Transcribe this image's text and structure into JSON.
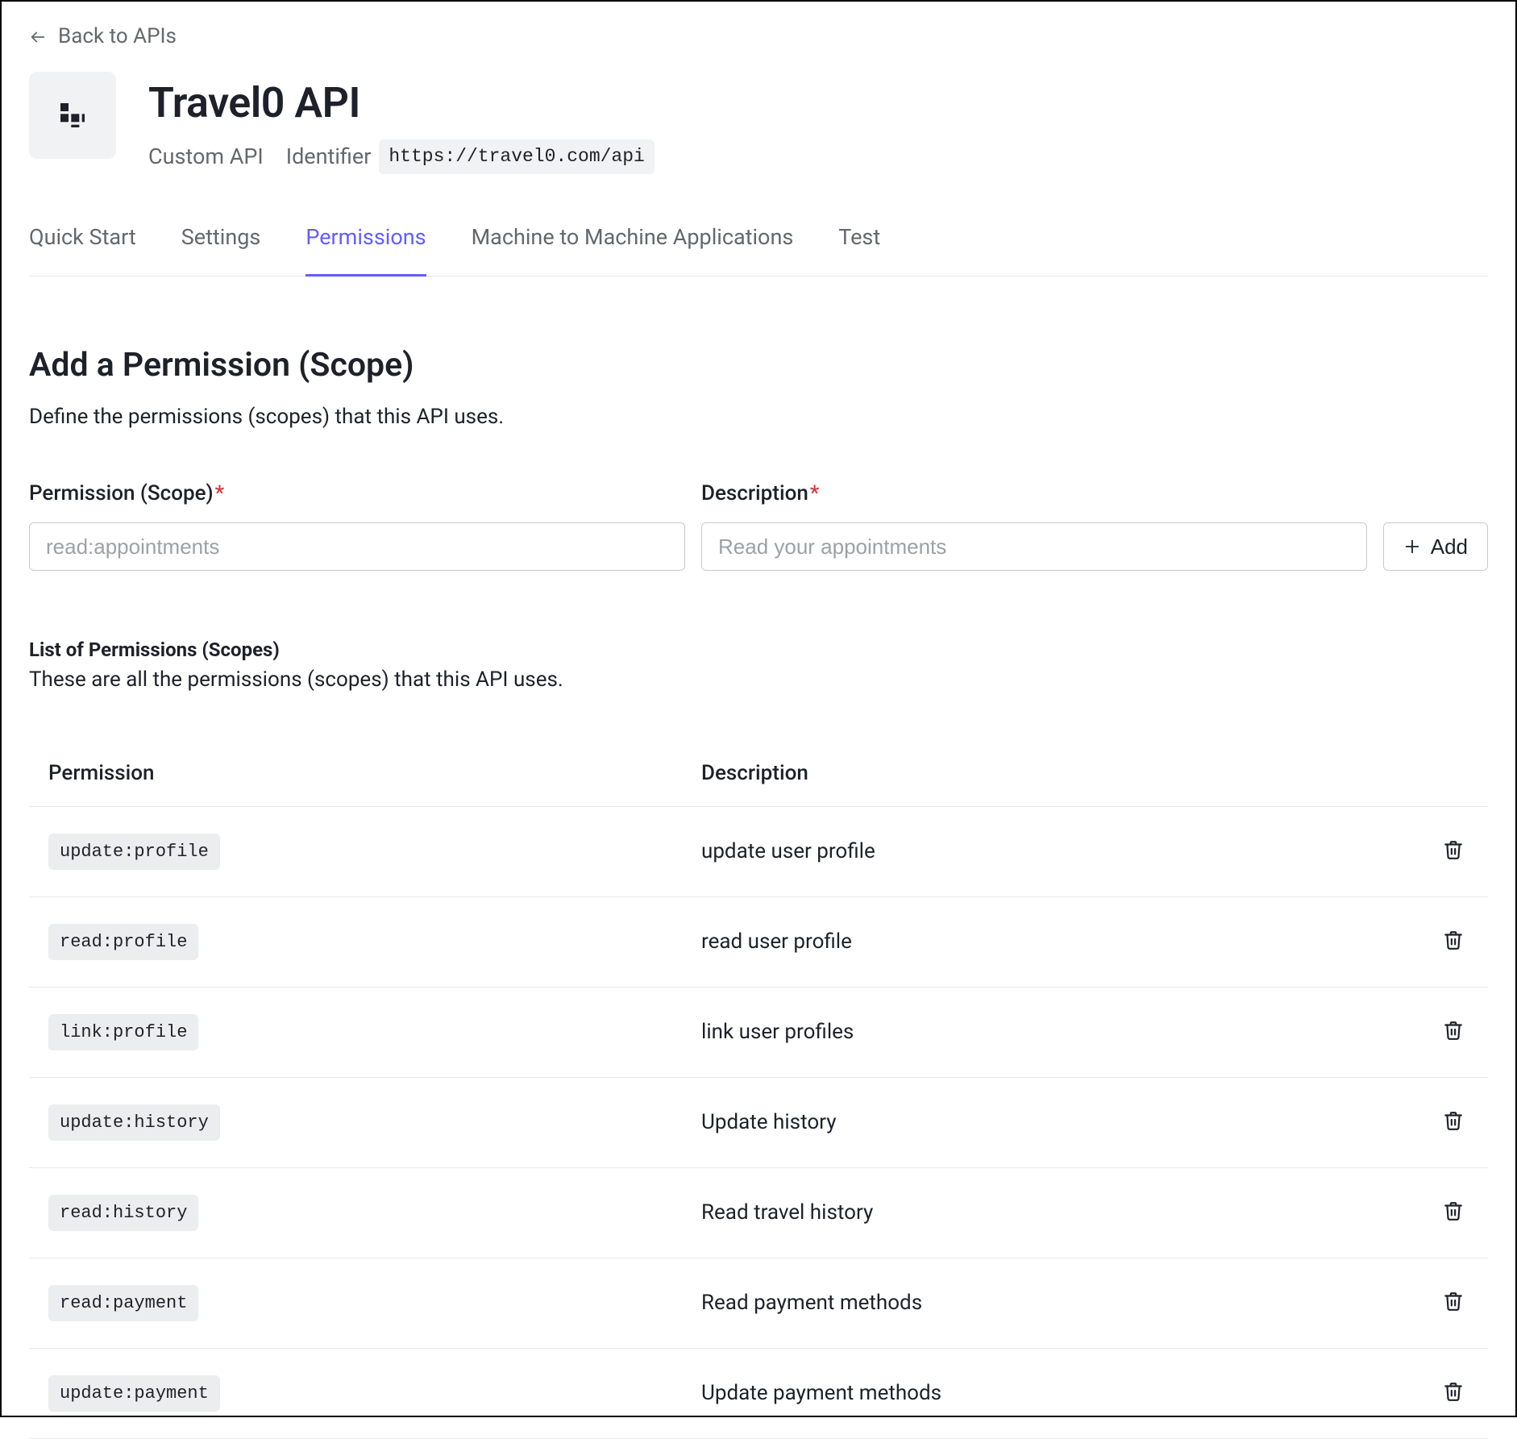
{
  "breadcrumb": {
    "back_label": "Back to APIs"
  },
  "header": {
    "name": "Travel0 API",
    "type_label": "Custom API",
    "identifier_label": "Identifier",
    "identifier_value": "https://travel0.com/api"
  },
  "tabs": [
    {
      "label": "Quick Start",
      "active": false
    },
    {
      "label": "Settings",
      "active": false
    },
    {
      "label": "Permissions",
      "active": true
    },
    {
      "label": "Machine to Machine Applications",
      "active": false
    },
    {
      "label": "Test",
      "active": false
    }
  ],
  "add_scope": {
    "heading": "Add a Permission (Scope)",
    "subtext": "Define the permissions (scopes) that this API uses.",
    "permission_label": "Permission (Scope)",
    "permission_placeholder": "read:appointments",
    "description_label": "Description",
    "description_placeholder": "Read your appointments",
    "add_button_label": "Add"
  },
  "list_scope": {
    "heading": "List of Permissions (Scopes)",
    "subtext": "These are all the permissions (scopes) that this API uses.",
    "col_permission": "Permission",
    "col_description": "Description",
    "rows": [
      {
        "permission": "update:profile",
        "description": "update user profile"
      },
      {
        "permission": "read:profile",
        "description": "read user profile"
      },
      {
        "permission": "link:profile",
        "description": "link user profiles"
      },
      {
        "permission": "update:history",
        "description": "Update history"
      },
      {
        "permission": "read:history",
        "description": "Read travel history"
      },
      {
        "permission": "read:payment",
        "description": "Read payment methods"
      },
      {
        "permission": "update:payment",
        "description": "Update payment methods"
      }
    ]
  }
}
